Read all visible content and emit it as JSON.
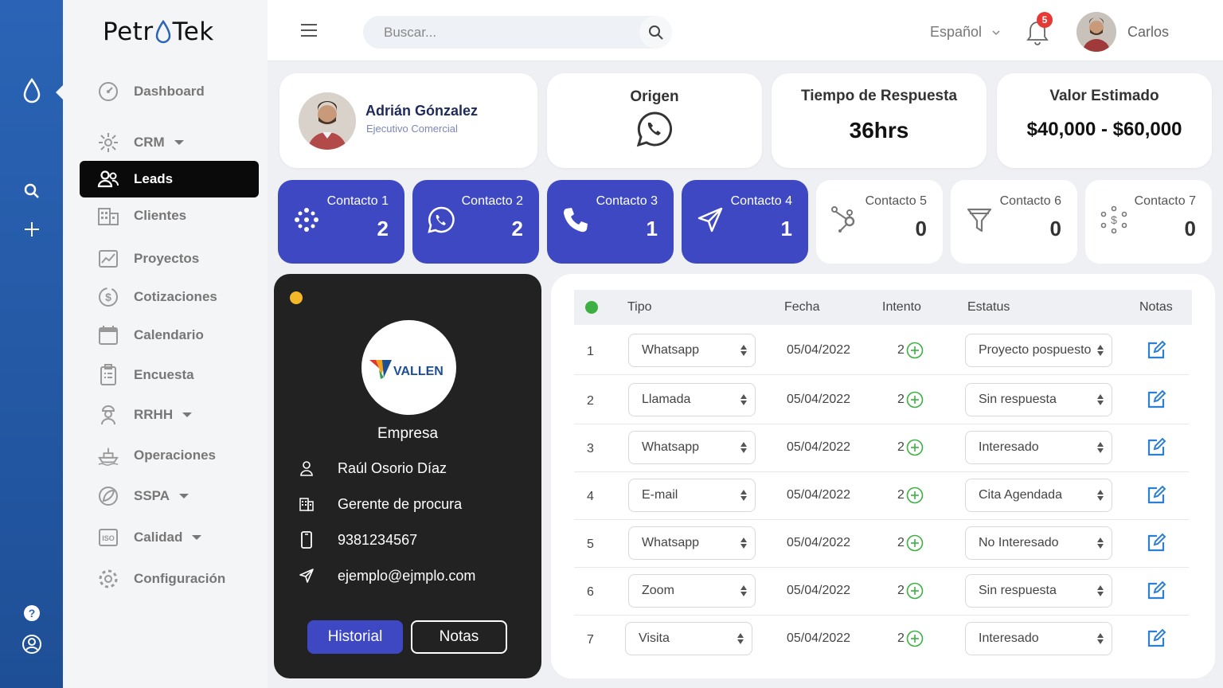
{
  "brand": {
    "logo_left": "Petr",
    "logo_right": "Tek",
    "accent": "#2b64b6",
    "primary": "#3d48c2"
  },
  "nav": [
    {
      "label": "Dashboard",
      "icon": "dashboard-icon"
    },
    {
      "label": "CRM",
      "icon": "crm-icon",
      "caret": true
    },
    {
      "label": "Leads",
      "icon": "users-icon",
      "active": true
    },
    {
      "label": "Clientes",
      "icon": "building-icon"
    },
    {
      "label": "Proyectos",
      "icon": "chart-icon"
    },
    {
      "label": "Cotizaciones",
      "icon": "dollar-icon"
    },
    {
      "label": "Calendario",
      "icon": "calendar-icon"
    },
    {
      "label": "Encuesta",
      "icon": "clipboard-icon"
    },
    {
      "label": "RRHH",
      "icon": "worker-icon",
      "caret": true
    },
    {
      "label": "Operaciones",
      "icon": "ship-icon"
    },
    {
      "label": "SSPA",
      "icon": "leaf-icon",
      "caret": true
    },
    {
      "label": "Calidad",
      "icon": "iso-icon",
      "caret": true
    },
    {
      "label": "Configuración",
      "icon": "gear-icon"
    }
  ],
  "header": {
    "search_placeholder": "Buscar...",
    "language": "Español",
    "notifications": "5",
    "user": "Carlos"
  },
  "profile": {
    "name": "Adrián Gónzalez",
    "role": "Ejecutivo Comercial"
  },
  "summary": {
    "origin_title": "Origen",
    "origin_icon": "whatsapp-icon",
    "response_title": "Tiempo de Respuesta",
    "response_value": "36hrs",
    "value_title": "Valor Estimado",
    "value_value": "$40,000 - $60,000"
  },
  "contacts": [
    {
      "label": "Contacto 1",
      "value": "2",
      "icon": "dots-icon",
      "style": "blue"
    },
    {
      "label": "Contacto 2",
      "value": "2",
      "icon": "whatsapp-icon",
      "style": "blue"
    },
    {
      "label": "Contacto 3",
      "value": "1",
      "icon": "phone-icon",
      "style": "blue"
    },
    {
      "label": "Contacto 4",
      "value": "1",
      "icon": "send-icon",
      "style": "blue"
    },
    {
      "label": "Contacto 5",
      "value": "0",
      "icon": "hubspot-icon",
      "style": "white"
    },
    {
      "label": "Contacto 6",
      "value": "0",
      "icon": "filter-icon",
      "style": "white"
    },
    {
      "label": "Contacto 7",
      "value": "0",
      "icon": "money-network-icon",
      "style": "white"
    }
  ],
  "company": {
    "logo_text": "VALLEN",
    "title": "Empresa",
    "contact_name": "Raúl Osorio Díaz",
    "position": "Gerente de procura",
    "phone": "9381234567",
    "email": "ejemplo@ejmplo.com",
    "btn_history": "Historial",
    "btn_notes": "Notas"
  },
  "table": {
    "headers": {
      "tipo": "Tipo",
      "fecha": "Fecha",
      "intento": "Intento",
      "estatus": "Estatus",
      "notas": "Notas"
    },
    "rows": [
      {
        "n": "1",
        "tipo": "Whatsapp",
        "fecha": "05/04/2022",
        "intento": "2",
        "estatus": "Proyecto pospuesto"
      },
      {
        "n": "2",
        "tipo": "Llamada",
        "fecha": "05/04/2022",
        "intento": "2",
        "estatus": "Sin respuesta"
      },
      {
        "n": "3",
        "tipo": "Whatsapp",
        "fecha": "05/04/2022",
        "intento": "2",
        "estatus": "Interesado"
      },
      {
        "n": "4",
        "tipo": "E-mail",
        "fecha": "05/04/2022",
        "intento": "2",
        "estatus": "Cita Agendada"
      },
      {
        "n": "5",
        "tipo": "Whatsapp",
        "fecha": "05/04/2022",
        "intento": "2",
        "estatus": "No Interesado"
      },
      {
        "n": "6",
        "tipo": "Zoom",
        "fecha": "05/04/2022",
        "intento": "2",
        "estatus": "Sin respuesta"
      },
      {
        "n": "7",
        "tipo": "Visita",
        "fecha": "05/04/2022",
        "intento": "2",
        "estatus": "Interesado"
      }
    ]
  }
}
